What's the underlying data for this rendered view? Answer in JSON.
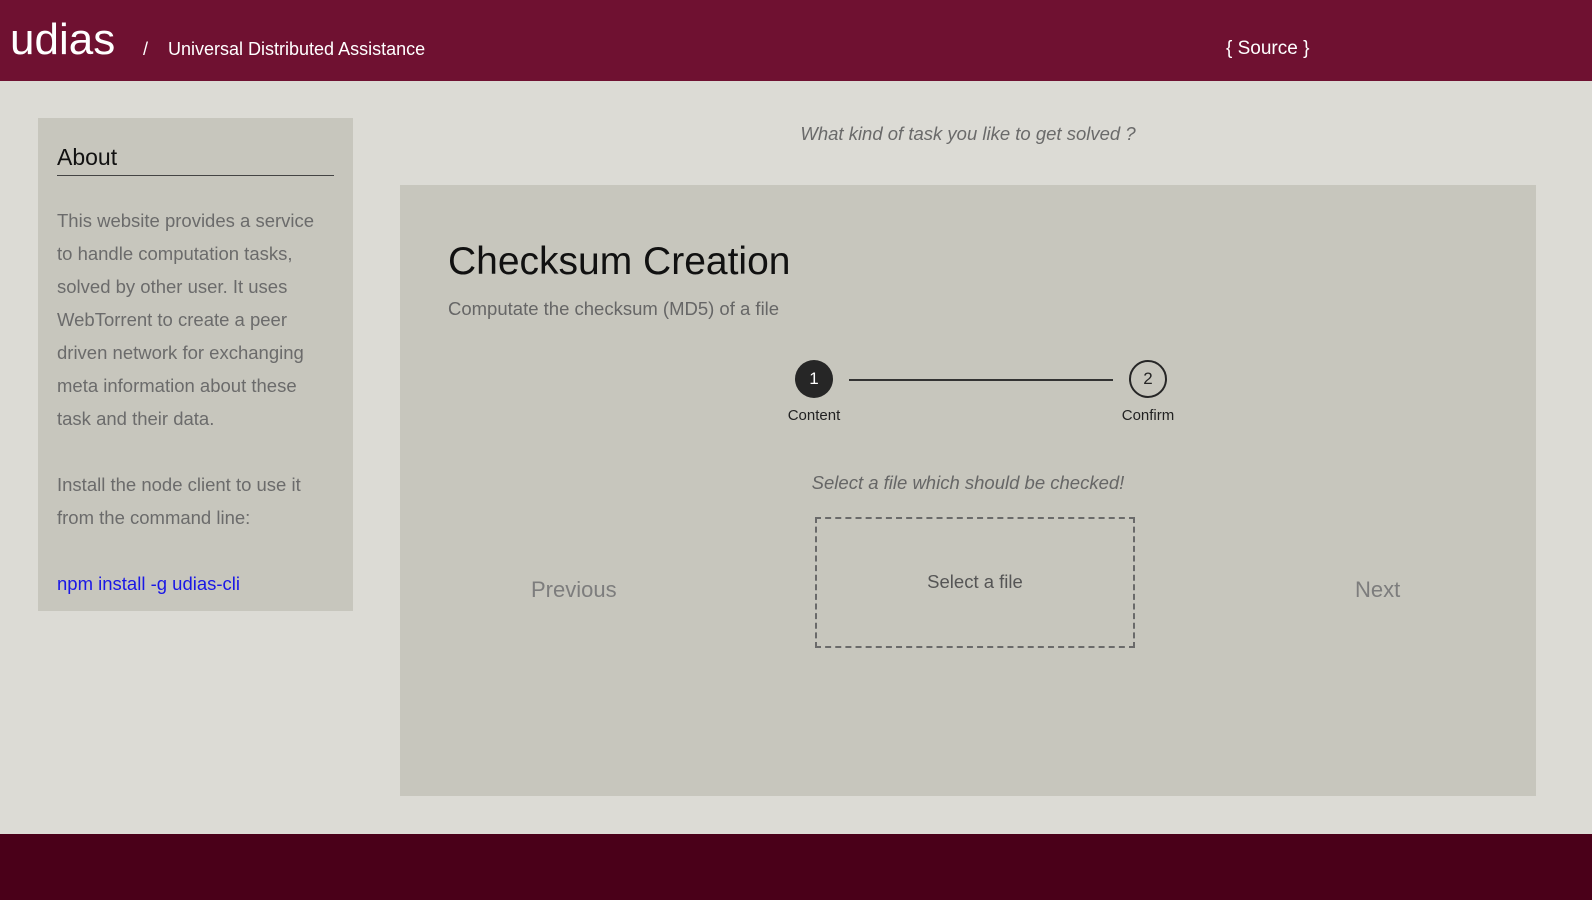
{
  "header": {
    "brand": "udias",
    "separator": "/",
    "tagline": "Universal Distributed Assistance",
    "source_link": "{ Source }"
  },
  "sidebar": {
    "title": "About",
    "description": "This website provides a service to handle computation tasks, solved by other user. It uses WebTorrent to create a peer driven network for exchanging meta information about these task and their data.",
    "install_text": "Install the node client to use it from the command line:",
    "install_command": "npm install -g udias-cli"
  },
  "main": {
    "question": "What kind of task you like to get solved ?",
    "task": {
      "title": "Checksum Creation",
      "description": "Computate the checksum (MD5) of a file"
    },
    "steps": [
      {
        "number": "1",
        "label": "Content",
        "active": true
      },
      {
        "number": "2",
        "label": "Confirm",
        "active": false
      }
    ],
    "instruction": "Select a file which should be checked!",
    "dropzone_label": "Select a file",
    "previous_label": "Previous",
    "next_label": "Next"
  },
  "colors": {
    "header_bg": "#6f1131",
    "footer_bg": "#4a0019",
    "page_bg": "#dcdbd5",
    "panel_bg": "#c7c6bd",
    "link": "#1a17e6"
  }
}
